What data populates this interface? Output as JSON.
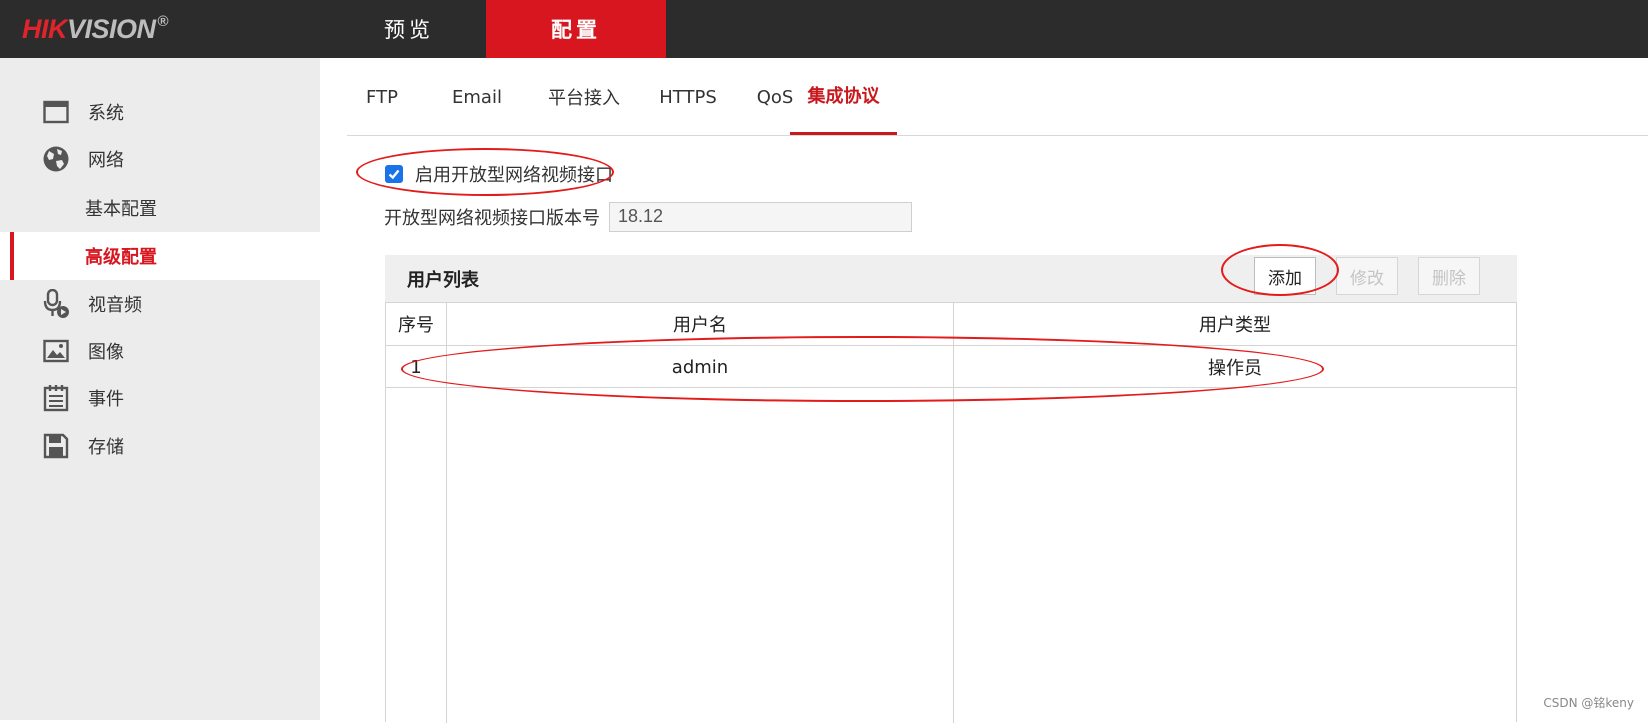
{
  "header": {
    "logo_brand": "HIKVISION",
    "logo_reg": "®",
    "nav": [
      {
        "label": "预览"
      },
      {
        "label": "配置"
      }
    ]
  },
  "sidebar": {
    "items": [
      {
        "label": "系统",
        "icon": "system-window-icon"
      },
      {
        "label": "网络",
        "icon": "globe-icon"
      },
      {
        "label": "基本配置"
      },
      {
        "label": "高级配置"
      },
      {
        "label": "视音频",
        "icon": "microphone-icon"
      },
      {
        "label": "图像",
        "icon": "image-icon"
      },
      {
        "label": "事件",
        "icon": "calendar-icon"
      },
      {
        "label": "存储",
        "icon": "save-icon"
      }
    ]
  },
  "tabs": [
    "FTP",
    "Email",
    "平台接入",
    "HTTPS",
    "QoS",
    "集成协议"
  ],
  "form": {
    "enable_label": "启用开放型网络视频接口",
    "enable_checked": true,
    "version_label": "开放型网络视频接口版本号",
    "version_value": "18.12"
  },
  "user_list": {
    "title": "用户列表",
    "buttons": {
      "add": "添加",
      "modify": "修改",
      "delete": "删除"
    },
    "columns": [
      "序号",
      "用户名",
      "用户类型"
    ],
    "rows": [
      {
        "index": "1",
        "username": "admin",
        "type": "操作员"
      }
    ]
  },
  "watermark": "CSDN @铭keny",
  "colors": {
    "accent": "#d7161f",
    "topbar": "#2c2c2c",
    "sidebar": "#ececec",
    "annotation": "#e31b1b"
  }
}
